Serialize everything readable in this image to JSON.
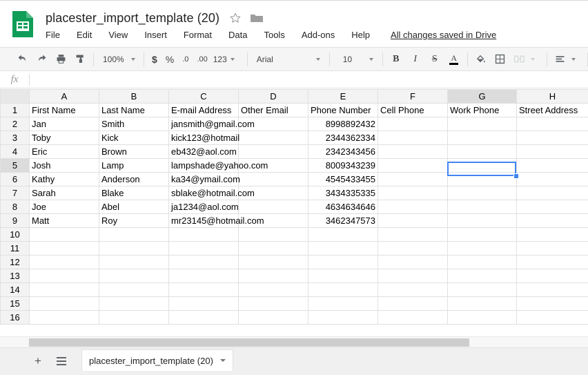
{
  "app": {
    "icon": "sheets-doc-icon",
    "title": "placester_import_template (20)",
    "star_icon": "star-outline-icon",
    "folder_icon": "folder-icon",
    "save_status": "All changes saved in Drive"
  },
  "menubar": {
    "items": [
      "File",
      "Edit",
      "View",
      "Insert",
      "Format",
      "Data",
      "Tools",
      "Add-ons",
      "Help"
    ]
  },
  "toolbar": {
    "undo_icon": "undo-icon",
    "redo_icon": "redo-icon",
    "print_icon": "print-icon",
    "paint_format_icon": "paint-format-icon",
    "zoom_value": "100%",
    "currency_label": "$",
    "percent_label": "%",
    "decrease_decimal_label": ".0",
    "increase_decimal_label": ".00",
    "more_formats_label": "123",
    "font_value": "Arial",
    "font_size_value": "10",
    "bold_label": "B",
    "italic_label": "I",
    "strikethrough_label": "S",
    "text_color_label": "A",
    "fill_color_icon": "fill-color-icon",
    "borders_icon": "borders-icon",
    "merge_cells_icon": "merge-cells-icon",
    "align_icon": "horizontal-align-icon"
  },
  "formula_bar": {
    "fx_label": "fx",
    "value": "",
    "placeholder": ""
  },
  "grid": {
    "columns": [
      "A",
      "B",
      "C",
      "D",
      "E",
      "F",
      "G",
      "H"
    ],
    "selected_column": "G",
    "selected_row": 5,
    "selected_cell": "G5",
    "row_numbers": [
      1,
      2,
      3,
      4,
      5,
      6,
      7,
      8,
      9,
      10,
      11,
      12,
      13,
      14,
      15,
      16
    ],
    "headers": [
      "First Name",
      "Last Name",
      "E-mail Address",
      "Other Email",
      "Phone Number",
      "Cell Phone",
      "Work Phone",
      "Street Address"
    ],
    "rows": [
      {
        "first_name": "Jan",
        "last_name": "Smith",
        "email": "jansmith@gmail.com",
        "other_email": "",
        "phone": "8998892432",
        "cell_phone": "",
        "work_phone": "",
        "street_address": ""
      },
      {
        "first_name": "Toby",
        "last_name": "Kick",
        "email": "kick123@hotmail",
        "other_email": "",
        "phone": "2344362334",
        "cell_phone": "",
        "work_phone": "",
        "street_address": ""
      },
      {
        "first_name": "Eric",
        "last_name": "Brown",
        "email": "eb432@aol.com",
        "other_email": "",
        "phone": "2342343456",
        "cell_phone": "",
        "work_phone": "",
        "street_address": ""
      },
      {
        "first_name": "Josh",
        "last_name": "Lamp",
        "email": "lampshade@yahoo.com",
        "other_email": "",
        "phone": "8009343239",
        "cell_phone": "",
        "work_phone": "",
        "street_address": ""
      },
      {
        "first_name": "Kathy",
        "last_name": "Anderson",
        "email": "ka34@ymail.com",
        "other_email": "",
        "phone": "4545433455",
        "cell_phone": "",
        "work_phone": "",
        "street_address": ""
      },
      {
        "first_name": "Sarah",
        "last_name": "Blake",
        "email": "sblake@hotmail.com",
        "other_email": "",
        "phone": "3434335335",
        "cell_phone": "",
        "work_phone": "",
        "street_address": ""
      },
      {
        "first_name": "Joe",
        "last_name": "Abel",
        "email": "ja1234@aol.com",
        "other_email": "",
        "phone": "4634634646",
        "cell_phone": "",
        "work_phone": "",
        "street_address": ""
      },
      {
        "first_name": "Matt",
        "last_name": "Roy",
        "email": "mr23145@hotmail.com",
        "other_email": "",
        "phone": "3462347573",
        "cell_phone": "",
        "work_phone": "",
        "street_address": ""
      }
    ]
  },
  "sheetbar": {
    "add_sheet_icon": "plus-icon",
    "all_sheets_icon": "hamburger-icon",
    "tab_name": "placester_import_template (20)",
    "tab_caret_icon": "chevron-down-icon"
  },
  "colors": {
    "accent": "#4285f4",
    "sheets_green": "#0f9d58",
    "toolbar_bg": "#f5f5f5",
    "header_bg": "#f3f3f3",
    "selected_header_bg": "#dcdcdc"
  }
}
